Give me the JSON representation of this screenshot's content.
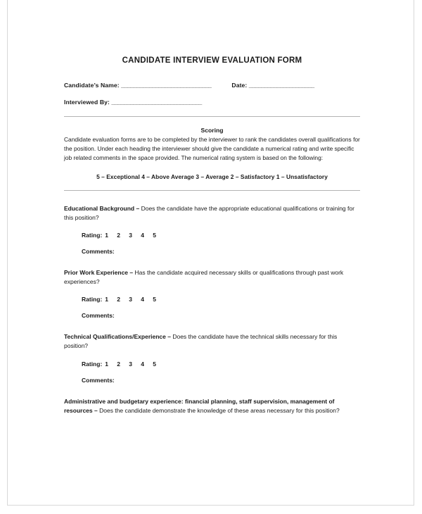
{
  "document": {
    "title": "CANDIDATE INTERVIEW EVALUATION FORM",
    "fields": {
      "candidate_name_label": "Candidate’s Name:",
      "candidate_name_rule": "_____________________________",
      "date_label": "Date:",
      "date_rule": "_____________________",
      "interviewed_by_label": "Interviewed By:",
      "interviewed_by_rule": "_____________________________"
    },
    "scoring": {
      "heading": "Scoring",
      "body": "Candidate evaluation forms are to be completed by the interviewer to rank the candidates overall qualifications for the position.  Under each heading the interviewer should give the candidate a numerical rating and write specific job related comments in the space provided.  The numerical rating system is based on the following:",
      "scale": "5 – Exceptional   4 – Above Average   3 – Average   2 – Satisfactory   1 – Unsatisfactory"
    },
    "rating_label": "Rating:",
    "rating_options": [
      "1",
      "2",
      "3",
      "4",
      "5"
    ],
    "comments_label": "Comments:",
    "sections": [
      {
        "heading": "Educational Background –",
        "question": " Does the candidate have the appropriate educational qualifications or training for this position?",
        "has_rating": true,
        "has_comments": true
      },
      {
        "heading": "Prior Work Experience –",
        "question": " Has the candidate acquired necessary skills or qualifications through past work experiences?",
        "has_rating": true,
        "has_comments": true
      },
      {
        "heading": "Technical Qualifications/Experience –",
        "question": " Does the candidate have the technical skills necessary for this position?",
        "has_rating": true,
        "has_comments": true
      },
      {
        "heading": "Administrative and budgetary experience: financial planning, staff supervision, management of resources –",
        "question": " Does the candidate demonstrate the knowledge of these areas necessary for this position?",
        "has_rating": false,
        "has_comments": false
      }
    ]
  }
}
